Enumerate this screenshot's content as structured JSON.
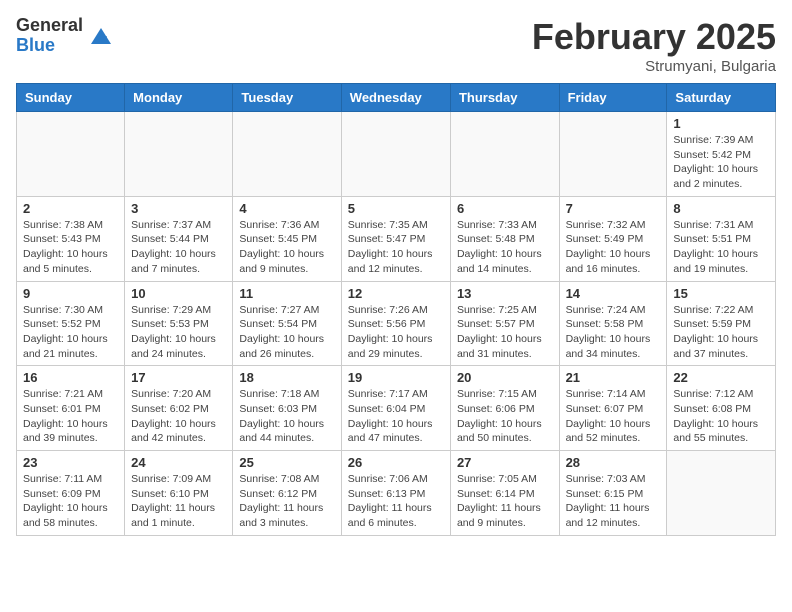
{
  "logo": {
    "general": "General",
    "blue": "Blue"
  },
  "title": "February 2025",
  "subtitle": "Strumyani, Bulgaria",
  "weekdays": [
    "Sunday",
    "Monday",
    "Tuesday",
    "Wednesday",
    "Thursday",
    "Friday",
    "Saturday"
  ],
  "weeks": [
    [
      {
        "day": "",
        "info": ""
      },
      {
        "day": "",
        "info": ""
      },
      {
        "day": "",
        "info": ""
      },
      {
        "day": "",
        "info": ""
      },
      {
        "day": "",
        "info": ""
      },
      {
        "day": "",
        "info": ""
      },
      {
        "day": "1",
        "info": "Sunrise: 7:39 AM\nSunset: 5:42 PM\nDaylight: 10 hours and 2 minutes."
      }
    ],
    [
      {
        "day": "2",
        "info": "Sunrise: 7:38 AM\nSunset: 5:43 PM\nDaylight: 10 hours and 5 minutes."
      },
      {
        "day": "3",
        "info": "Sunrise: 7:37 AM\nSunset: 5:44 PM\nDaylight: 10 hours and 7 minutes."
      },
      {
        "day": "4",
        "info": "Sunrise: 7:36 AM\nSunset: 5:45 PM\nDaylight: 10 hours and 9 minutes."
      },
      {
        "day": "5",
        "info": "Sunrise: 7:35 AM\nSunset: 5:47 PM\nDaylight: 10 hours and 12 minutes."
      },
      {
        "day": "6",
        "info": "Sunrise: 7:33 AM\nSunset: 5:48 PM\nDaylight: 10 hours and 14 minutes."
      },
      {
        "day": "7",
        "info": "Sunrise: 7:32 AM\nSunset: 5:49 PM\nDaylight: 10 hours and 16 minutes."
      },
      {
        "day": "8",
        "info": "Sunrise: 7:31 AM\nSunset: 5:51 PM\nDaylight: 10 hours and 19 minutes."
      }
    ],
    [
      {
        "day": "9",
        "info": "Sunrise: 7:30 AM\nSunset: 5:52 PM\nDaylight: 10 hours and 21 minutes."
      },
      {
        "day": "10",
        "info": "Sunrise: 7:29 AM\nSunset: 5:53 PM\nDaylight: 10 hours and 24 minutes."
      },
      {
        "day": "11",
        "info": "Sunrise: 7:27 AM\nSunset: 5:54 PM\nDaylight: 10 hours and 26 minutes."
      },
      {
        "day": "12",
        "info": "Sunrise: 7:26 AM\nSunset: 5:56 PM\nDaylight: 10 hours and 29 minutes."
      },
      {
        "day": "13",
        "info": "Sunrise: 7:25 AM\nSunset: 5:57 PM\nDaylight: 10 hours and 31 minutes."
      },
      {
        "day": "14",
        "info": "Sunrise: 7:24 AM\nSunset: 5:58 PM\nDaylight: 10 hours and 34 minutes."
      },
      {
        "day": "15",
        "info": "Sunrise: 7:22 AM\nSunset: 5:59 PM\nDaylight: 10 hours and 37 minutes."
      }
    ],
    [
      {
        "day": "16",
        "info": "Sunrise: 7:21 AM\nSunset: 6:01 PM\nDaylight: 10 hours and 39 minutes."
      },
      {
        "day": "17",
        "info": "Sunrise: 7:20 AM\nSunset: 6:02 PM\nDaylight: 10 hours and 42 minutes."
      },
      {
        "day": "18",
        "info": "Sunrise: 7:18 AM\nSunset: 6:03 PM\nDaylight: 10 hours and 44 minutes."
      },
      {
        "day": "19",
        "info": "Sunrise: 7:17 AM\nSunset: 6:04 PM\nDaylight: 10 hours and 47 minutes."
      },
      {
        "day": "20",
        "info": "Sunrise: 7:15 AM\nSunset: 6:06 PM\nDaylight: 10 hours and 50 minutes."
      },
      {
        "day": "21",
        "info": "Sunrise: 7:14 AM\nSunset: 6:07 PM\nDaylight: 10 hours and 52 minutes."
      },
      {
        "day": "22",
        "info": "Sunrise: 7:12 AM\nSunset: 6:08 PM\nDaylight: 10 hours and 55 minutes."
      }
    ],
    [
      {
        "day": "23",
        "info": "Sunrise: 7:11 AM\nSunset: 6:09 PM\nDaylight: 10 hours and 58 minutes."
      },
      {
        "day": "24",
        "info": "Sunrise: 7:09 AM\nSunset: 6:10 PM\nDaylight: 11 hours and 1 minute."
      },
      {
        "day": "25",
        "info": "Sunrise: 7:08 AM\nSunset: 6:12 PM\nDaylight: 11 hours and 3 minutes."
      },
      {
        "day": "26",
        "info": "Sunrise: 7:06 AM\nSunset: 6:13 PM\nDaylight: 11 hours and 6 minutes."
      },
      {
        "day": "27",
        "info": "Sunrise: 7:05 AM\nSunset: 6:14 PM\nDaylight: 11 hours and 9 minutes."
      },
      {
        "day": "28",
        "info": "Sunrise: 7:03 AM\nSunset: 6:15 PM\nDaylight: 11 hours and 12 minutes."
      },
      {
        "day": "",
        "info": ""
      }
    ]
  ]
}
